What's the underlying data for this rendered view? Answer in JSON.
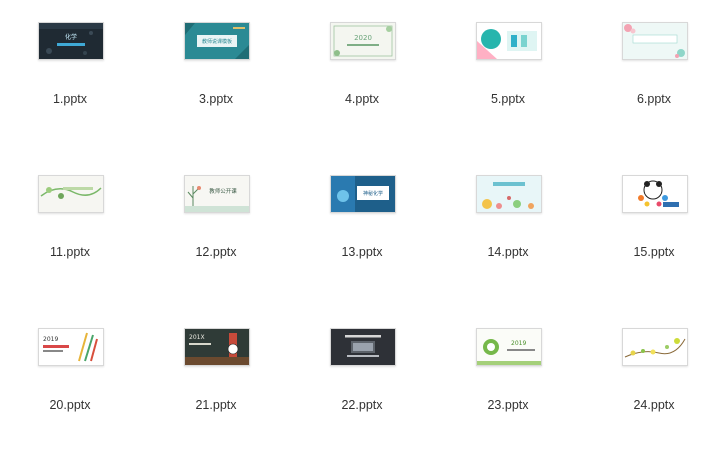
{
  "files": [
    {
      "name": "1.pptx",
      "theme": "chalk-chemistry"
    },
    {
      "name": "3.pptx",
      "theme": "teal-teaching"
    },
    {
      "name": "4.pptx",
      "theme": "green-leaf-2020"
    },
    {
      "name": "5.pptx",
      "theme": "teal-geometric"
    },
    {
      "name": "6.pptx",
      "theme": "floral-pink"
    },
    {
      "name": "11.pptx",
      "theme": "green-vine"
    },
    {
      "name": "12.pptx",
      "theme": "botanical-open-class"
    },
    {
      "name": "13.pptx",
      "theme": "blue-lab"
    },
    {
      "name": "14.pptx",
      "theme": "floral-sun"
    },
    {
      "name": "15.pptx",
      "theme": "panda-colorful"
    },
    {
      "name": "20.pptx",
      "theme": "pencils-2019"
    },
    {
      "name": "21.pptx",
      "theme": "chalkboard-clock"
    },
    {
      "name": "22.pptx",
      "theme": "dark-computer"
    },
    {
      "name": "23.pptx",
      "theme": "green-2019"
    },
    {
      "name": "24.pptx",
      "theme": "flower-branch"
    }
  ],
  "text": {
    "t1": "化学",
    "t3": "教师说课模板",
    "t4": "2020",
    "t12": "教师公开课",
    "t13": "神秘化学",
    "t20": "2019",
    "t21": "201X",
    "t23": "2019"
  }
}
